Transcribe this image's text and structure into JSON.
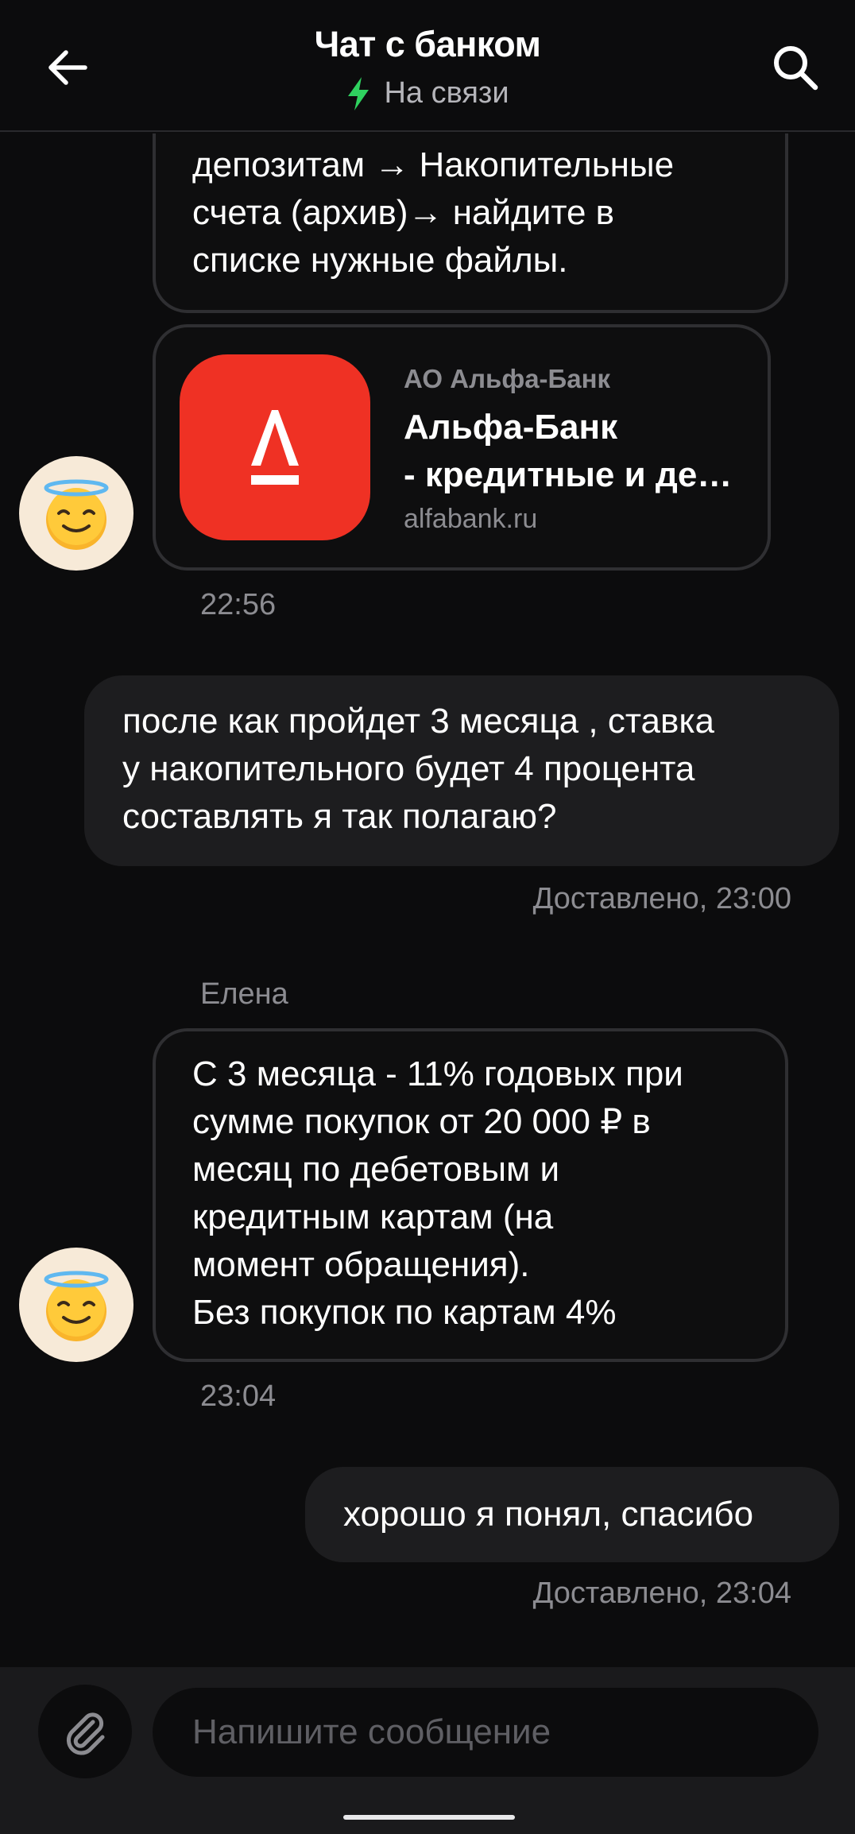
{
  "header": {
    "title": "Чат с банком",
    "status": "На связи",
    "back_icon": "arrow-left-icon",
    "search_icon": "search-icon",
    "status_icon": "lightning-icon",
    "status_color": "#2fd25f"
  },
  "messages": [
    {
      "text": "депозитам → Накопительные\nсчета (архив)→ найдите в\nсписке нужные файлы."
    },
    {
      "link": {
        "source": "АО Альфа-Банк",
        "title_line1": "Альфа-Банк",
        "title_line2": "- кредитные и де…",
        "domain": "alfabank.ru",
        "logo_letter": "А",
        "logo_color": "#ef3124"
      },
      "time": "22:56"
    },
    {
      "text": "после как пройдет 3 месяца , ставка\nу накопительного будет 4 процента\nсоставлять я так полагаю?",
      "meta": "Доставлено, 23:00"
    },
    {
      "sender": "Елена",
      "text": "С 3 месяца - 11% годовых  при\nсумме покупок от 20 000 ₽ в\nмесяц по дебетовым и\nкредитным картам (на\nмомент обращения).\nБез покупок по картам 4%",
      "time": "23:04"
    },
    {
      "text": "хорошо я понял, спасибо",
      "meta": "Доставлено, 23:04"
    }
  ],
  "composer": {
    "placeholder": "Напишите сообщение",
    "attach_icon": "paperclip-icon"
  }
}
